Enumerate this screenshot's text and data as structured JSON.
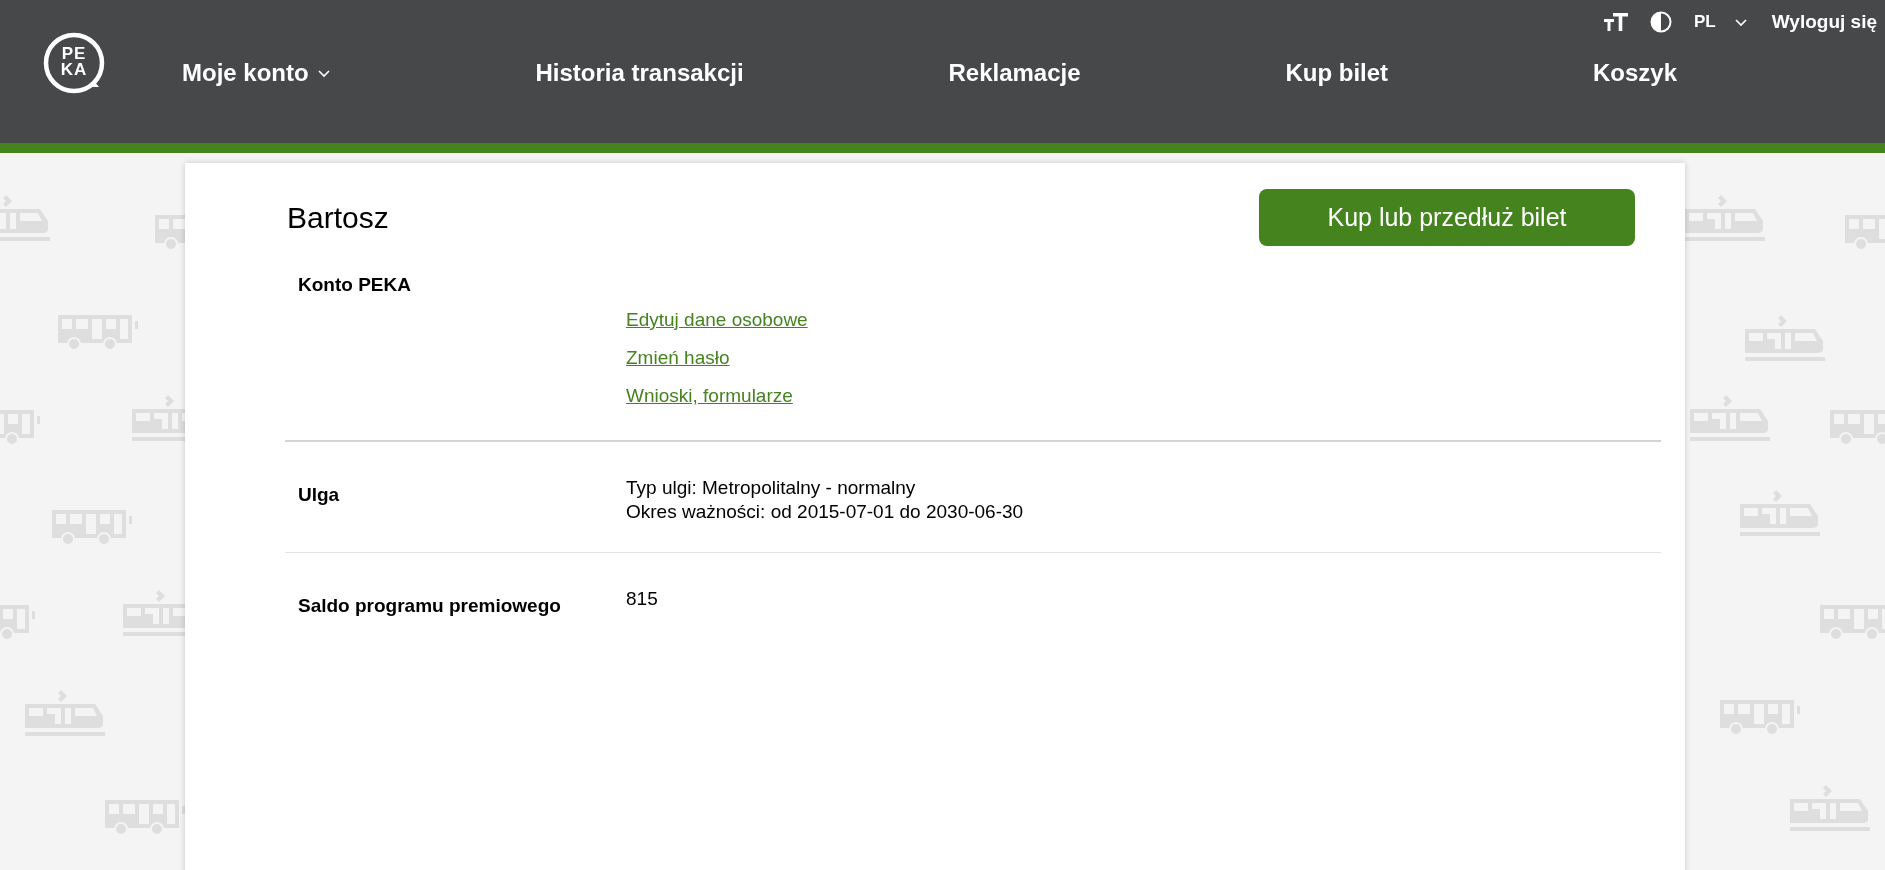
{
  "header": {
    "logo": {
      "lines": [
        "PE",
        "KA"
      ]
    },
    "utility": {
      "language": "PL",
      "logout": "Wyloguj się"
    },
    "nav": [
      {
        "label": "Moje konto",
        "dropdown": true
      },
      {
        "label": "Historia transakcji",
        "dropdown": false
      },
      {
        "label": "Reklamacje",
        "dropdown": false
      },
      {
        "label": "Kup bilet",
        "dropdown": false
      },
      {
        "label": "Koszyk",
        "dropdown": false
      }
    ]
  },
  "account": {
    "name": "Bartosz",
    "action_button": "Kup lub przedłuż bilet",
    "sections": [
      {
        "kind": "links",
        "label": "Konto PEKA",
        "links": [
          "Edytuj dane osobowe",
          "Zmień hasło",
          "Wnioski, formularze"
        ]
      },
      {
        "kind": "text",
        "label": "Ulga",
        "lines": [
          "Typ ulgi: Metropolitalny - normalny",
          "Okres ważności: od 2015-07-01 do 2030-06-30"
        ]
      },
      {
        "kind": "text",
        "label": "Saldo programu premiowego",
        "lines": [
          "815"
        ]
      }
    ]
  }
}
